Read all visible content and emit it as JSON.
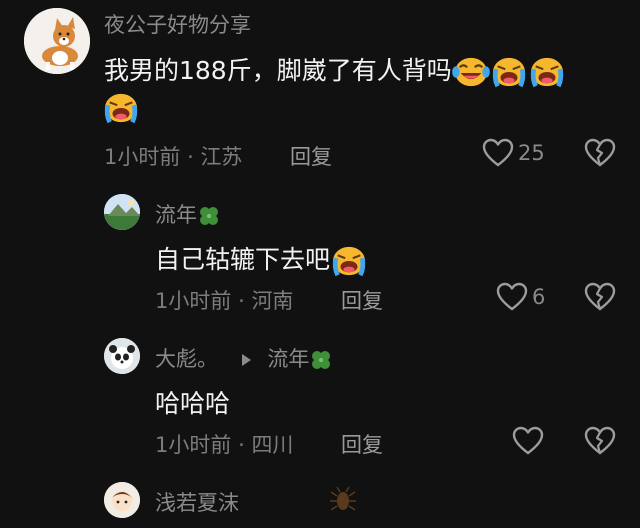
{
  "comments": [
    {
      "author": "夜公子好物分享",
      "text": "我男的188斤，脚崴了有人背吗",
      "time": "1小时前",
      "location": "江苏",
      "reply_label": "回复",
      "likes": "25"
    },
    {
      "author": "流年",
      "text": "自己轱辘下去吧",
      "time": "1小时前",
      "location": "河南",
      "reply_label": "回复",
      "likes": "6"
    },
    {
      "author": "大彪。",
      "reply_to": "流年",
      "text": "哈哈哈",
      "time": "1小时前",
      "location": "四川",
      "reply_label": "回复",
      "likes": ""
    },
    {
      "author": "浅若夏沫"
    }
  ],
  "separator": "·",
  "colors": {
    "background": "#111112",
    "name": "#8a8a8a",
    "text": "#f2f2f2",
    "emoji": "#f5b82e"
  },
  "icons": [
    "corgi-avatar",
    "landscape-avatar",
    "panda-avatar",
    "cartoon-avatar",
    "heart-icon",
    "broken-heart-icon",
    "clover-icon",
    "laugh-cry-emoji",
    "cry-emoji",
    "play-arrow-icon",
    "bug-icon"
  ]
}
